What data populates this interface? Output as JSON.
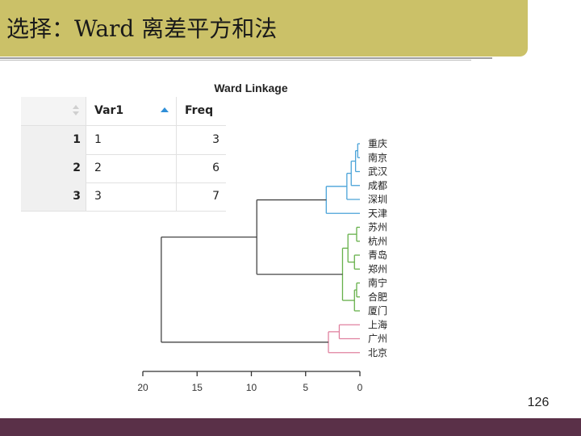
{
  "slide": {
    "title": "选择：Ward 离差平方和法",
    "page_number": "126"
  },
  "table": {
    "headers": [
      "",
      "Var1",
      "Freq"
    ],
    "rows": [
      {
        "index": "1",
        "var1": "1",
        "freq": "3"
      },
      {
        "index": "2",
        "var1": "2",
        "freq": "6"
      },
      {
        "index": "3",
        "var1": "3",
        "freq": "7"
      }
    ],
    "sort_column": "Var1",
    "sort_direction": "ascending"
  },
  "chart_data": {
    "type": "dendrogram",
    "title": "Ward Linkage",
    "orientation": "horizontal",
    "leaf_side": "right",
    "x_axis": {
      "reversed": true,
      "ticks": [
        20,
        15,
        10,
        5,
        0
      ],
      "range": [
        20,
        0
      ]
    },
    "grid": false,
    "leaves": [
      "重庆",
      "南京",
      "武汉",
      "成都",
      "深圳",
      "天津",
      "苏州",
      "杭州",
      "青岛",
      "郑州",
      "南宁",
      "合肥",
      "厦门",
      "上海",
      "广州",
      "北京"
    ],
    "clusters": [
      {
        "color": "#4aa3d8",
        "leaves": [
          "重庆",
          "南京",
          "武汉",
          "成都",
          "深圳",
          "天津"
        ]
      },
      {
        "color": "#66b04a",
        "leaves": [
          "苏州",
          "杭州",
          "青岛",
          "郑州",
          "南宁",
          "合肥",
          "厦门"
        ]
      },
      {
        "color": "#e0819f",
        "leaves": [
          "上海",
          "广州",
          "北京"
        ]
      }
    ],
    "link_color": "#444444",
    "merges": [
      {
        "left": "重庆",
        "right": "南京",
        "height": 0.2,
        "color": "#4aa3d8"
      },
      {
        "left": "A",
        "right": "武汉",
        "height": 0.4,
        "color": "#4aa3d8",
        "id": "A2",
        "left_ref": "重庆+南京"
      },
      {
        "left": "A2",
        "right": "成都",
        "height": 0.8,
        "color": "#4aa3d8",
        "id": "A3"
      },
      {
        "left": "A3",
        "right": "深圳",
        "height": 1.2,
        "color": "#4aa3d8",
        "id": "A4"
      },
      {
        "left": "A4",
        "right": "天津",
        "height": 3.1,
        "color": "#4aa3d8",
        "id": "B1"
      },
      {
        "left": "苏州",
        "right": "杭州",
        "height": 0.3,
        "color": "#66b04a",
        "id": "G1"
      },
      {
        "left": "青岛",
        "right": "郑州",
        "height": 0.5,
        "color": "#66b04a",
        "id": "G2"
      },
      {
        "left": "G1",
        "right": "G2",
        "height": 1.1,
        "color": "#66b04a",
        "id": "G3"
      },
      {
        "left": "南宁",
        "right": "合肥",
        "height": 0.3,
        "color": "#66b04a",
        "id": "G4"
      },
      {
        "left": "G4",
        "right": "厦门",
        "height": 0.5,
        "color": "#66b04a",
        "id": "G5"
      },
      {
        "left": "G3",
        "right": "G5",
        "height": 1.6,
        "color": "#66b04a",
        "id": "G6"
      },
      {
        "left": "B1",
        "right": "G6",
        "height": 9.5,
        "color": "#444444",
        "id": "BG"
      },
      {
        "left": "上海",
        "right": "广州",
        "height": 1.9,
        "color": "#e0819f",
        "id": "P1"
      },
      {
        "left": "P1",
        "right": "北京",
        "height": 2.9,
        "color": "#e0819f",
        "id": "P2"
      },
      {
        "left": "BG",
        "right": "P2",
        "height": 18.3,
        "color": "#444444",
        "id": "ROOT"
      }
    ]
  }
}
